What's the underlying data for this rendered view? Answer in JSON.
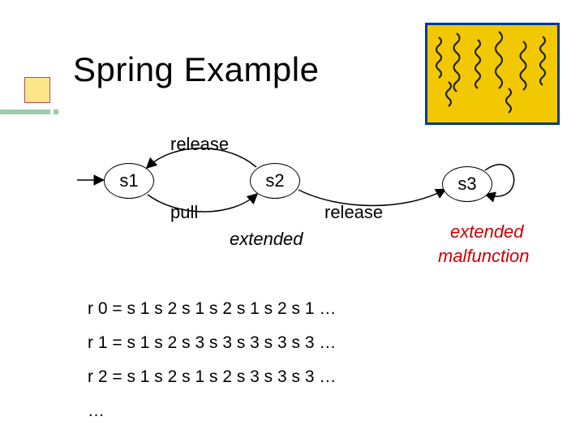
{
  "title": "Spring Example",
  "states": {
    "s1": "s1",
    "s2": "s2",
    "s3": "s3"
  },
  "edge_labels": {
    "release_top": "release",
    "pull": "pull",
    "release_mid": "release"
  },
  "annotations": {
    "extended_s2": "extended",
    "extended_s3": "extended",
    "malfunction": "malfunction"
  },
  "traces": {
    "r0": "r 0 = s 1 s 2 s 1 s 2 s 1 s 2 s 1 …",
    "r1": "r 1 = s 1 s 2 s 3 s 3 s 3 s 3 s 3 …",
    "r2": "r 2 = s 1 s 2 s 1 s 2 s 3 s 3 s 3 …",
    "dots": "…"
  }
}
